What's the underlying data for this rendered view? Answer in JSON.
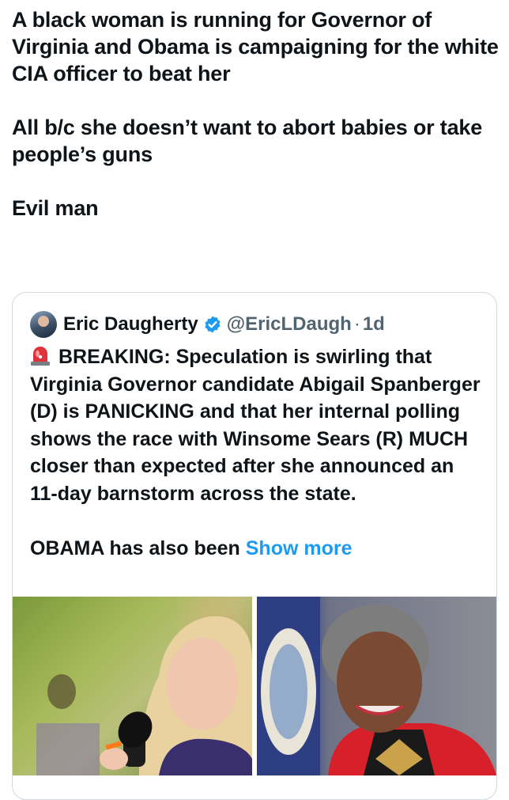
{
  "tweet": {
    "paragraphs": [
      "A black woman is running for Governor of Virginia and Obama is campaigning for the white CIA officer to beat her",
      "All b/c she doesn’t want to abort babies or take people’s guns",
      "Evil man"
    ]
  },
  "quote": {
    "author_name": "Eric Daugherty",
    "handle": "@EricLDaugh",
    "separator": "·",
    "age": "1d",
    "body_paragraphs": [
      "BREAKING: Speculation is swirling that Virginia Governor candidate Abigail Spanberger (D) is PANICKING and that her internal polling shows the race with Winsome Sears (R) MUCH closer than expected after she announced an 11-day barnstorm across the state."
    ],
    "truncated_text": "OBAMA has also been ",
    "show_more_label": "Show more",
    "icons": {
      "verified": "verified-badge-icon",
      "siren": "siren-emoji-icon"
    },
    "accent_color": "#1d9bf0"
  }
}
